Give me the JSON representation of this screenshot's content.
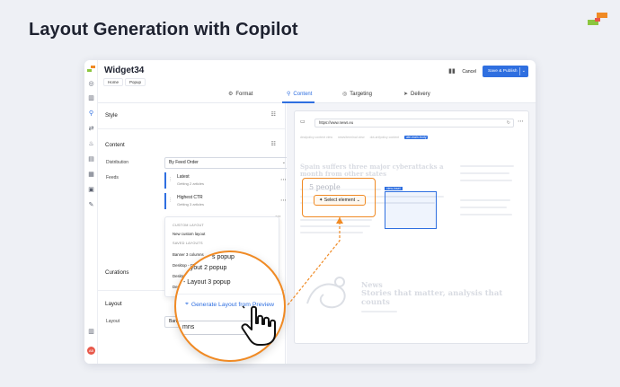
{
  "page": {
    "headline": "Layout Generation with Copilot"
  },
  "app": {
    "title": "Widget34",
    "breadcrumbs": [
      "Home",
      "Popup"
    ],
    "actions": {
      "cancel": "Cancel",
      "save": "Save & Publish"
    },
    "tabs": [
      {
        "label": "Format",
        "icon": "brush-icon"
      },
      {
        "label": "Content",
        "icon": "pin-icon",
        "active": true
      },
      {
        "label": "Targeting",
        "icon": "target-icon"
      },
      {
        "label": "Delivery",
        "icon": "send-icon"
      }
    ]
  },
  "panel": {
    "style_title": "Style",
    "content_title": "Content",
    "distribution_label": "Distribution",
    "distribution_value": "By Feed Order",
    "feeds_label": "Feeds",
    "feeds": [
      {
        "name": "Latest",
        "sub": "Getting 2 articles"
      },
      {
        "name": "Highest CTR",
        "sub": "Getting 3 articles"
      }
    ],
    "curations_label": "Curations",
    "layout_title": "Layout",
    "layout_label": "Layout",
    "layout_value": "Banner 3 c"
  },
  "dropdown": {
    "custom_head": "CUSTOM LAYOUT",
    "new_custom": "New custom layout",
    "saved_head": "SAVED LAYOUTS",
    "items": [
      "Banner 3 columns",
      "Desktop - CTA",
      "Desktop - CTA",
      "Desktop - "
    ]
  },
  "magnifier": {
    "items": [
      "s popup",
      "ayout 2 popup",
      "- Layout 3 popup"
    ],
    "generate": "Generate Layout from Preview",
    "field_value": "mns"
  },
  "preview": {
    "url": "https://www.news.eu",
    "breadcrumb": [
      "dealpolicy content view",
      "news/terminal view",
      "dot-art/policy content",
      "ate-main-body"
    ],
    "headline1": "Spain suffers three major cyberattacks a month from other states",
    "headline2": "Stories that matter, analysis that counts",
    "news_label": "News",
    "people": "5 people",
    "select_element": "Select element",
    "sel_tag": "view-inset"
  }
}
